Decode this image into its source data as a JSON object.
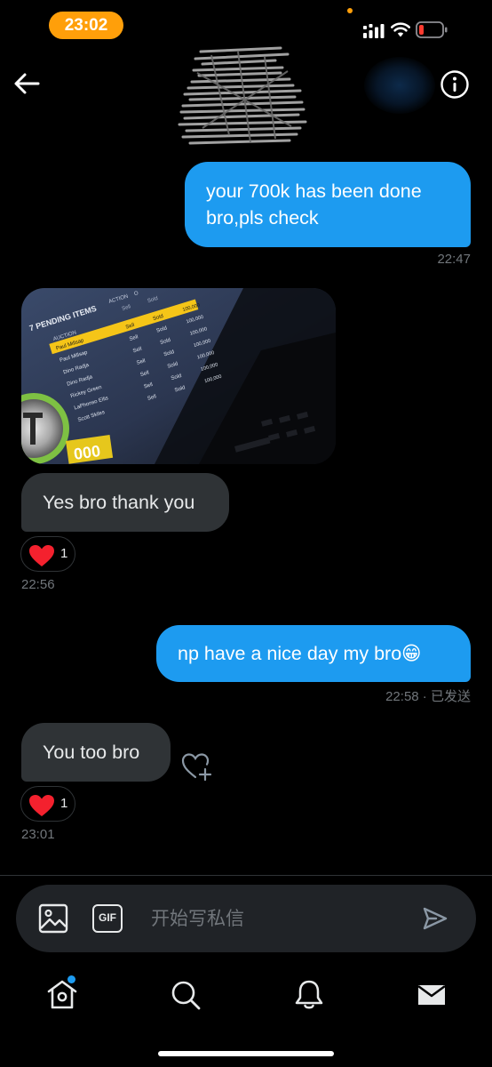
{
  "status_bar": {
    "time": "23:02",
    "icons": [
      "signal-icon",
      "wifi-icon",
      "battery-low-icon"
    ],
    "time_pill_color": "#ff9f0a",
    "battery_color": "#ff3b30"
  },
  "header": {
    "icons": [
      "back-arrow-icon",
      "info-icon"
    ]
  },
  "messages": [
    {
      "direction": "outgoing",
      "text": "your 700k has been done bro,pls check",
      "time": "22:47"
    },
    {
      "direction": "incoming",
      "type": "image",
      "image_text": {
        "title": "7 PENDING ITEMS",
        "col_action": "ACTION",
        "col_other": "O",
        "col_auction": "AUCTION",
        "col_sell": "Sell",
        "col_sold": "Sold",
        "players": [
          "Paul Millsap",
          "Paul Millsap",
          "Dino Radja",
          "Dino Radja",
          "Rickey Green",
          "LaPhonso Ellis",
          "Scott Skiles"
        ],
        "actions": [
          "Sell",
          "Sell",
          "Sell",
          "Sell",
          "Sell",
          "Sell",
          "Sell"
        ],
        "statuses": [
          "Sold",
          "Sold",
          "Sold",
          "Sold",
          "Sold",
          "Sold",
          "Sold"
        ],
        "prices": [
          "100,000",
          "100,000",
          "100,000",
          "100,000",
          "100,000",
          "100,000",
          "100,000"
        ],
        "coin_text": "000"
      }
    },
    {
      "direction": "incoming",
      "text": "Yes bro thank you",
      "reaction_count": "1",
      "time": "22:56"
    },
    {
      "direction": "outgoing",
      "text": "np have a nice day my bro😁",
      "time": "22:58",
      "separator": " · ",
      "status": "已发送"
    },
    {
      "direction": "incoming",
      "text": "You too bro",
      "reaction_count": "1",
      "time": "23:01"
    }
  ],
  "composer": {
    "placeholder": "开始写私信",
    "gif_label": "GIF",
    "icons": [
      "image-icon",
      "gif-icon",
      "send-icon"
    ]
  },
  "tab_bar": {
    "tabs": [
      "home",
      "search",
      "notifications",
      "messages"
    ],
    "home_badge_color": "#1d9bf0"
  },
  "colors": {
    "accent": "#1d9bf0",
    "incoming_bubble": "#2f3336",
    "heart": "#f91880",
    "muted_text": "#71767b"
  }
}
